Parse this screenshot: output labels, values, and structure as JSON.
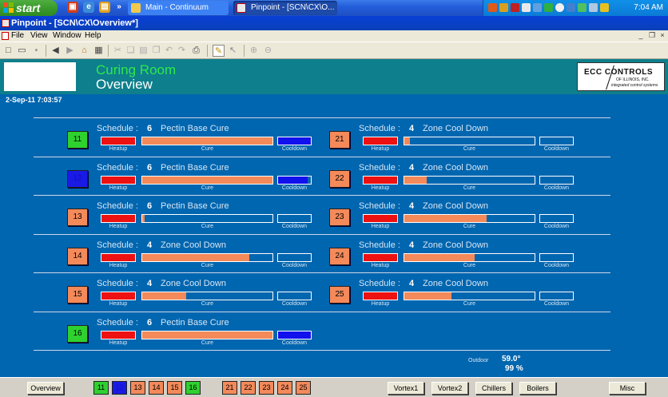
{
  "colors": {
    "heatup": "#ee1111",
    "cure": "#f4895a",
    "cooldown": "#1111ee",
    "room_green": "#2fd12f",
    "room_blue": "#1a1ae6",
    "room_orange": "#f4895a"
  },
  "taskbar": {
    "start_label": "start",
    "tasks": [
      {
        "label": "Main - Continuum",
        "icon": "continuum-icon"
      },
      {
        "label": "Pinpoint - [SCN\\CX\\O...",
        "icon": "pinpoint-icon"
      }
    ],
    "clock": "7:04 AM"
  },
  "window": {
    "title": "Pinpoint - [SCN\\CX\\Overview*]"
  },
  "menu": [
    "File",
    "View",
    "Window",
    "Help"
  ],
  "header": {
    "room_title": "Curing Room",
    "page_title": "Overview",
    "logo_main": "ECC CONTROLS",
    "logo_sub": "OF ILLINOIS, INC.",
    "logo_tag": "integrated control systems"
  },
  "datetime": "2-Sep-11  7:03:57",
  "labels": {
    "schedule": "Schedule :",
    "heatup": "Heatup",
    "cure": "Cure",
    "cooldown": "Cooldown"
  },
  "rooms": [
    {
      "id": "11",
      "schedule_num": "6",
      "schedule_name": "Pectin Base Cure",
      "status": "green",
      "heatup": 1.0,
      "cure": 1.0,
      "cooldown": 1.0
    },
    {
      "id": "21",
      "schedule_num": "4",
      "schedule_name": "Zone Cool Down",
      "status": "orange",
      "heatup": 1.0,
      "cure": 0.04,
      "cooldown": 0.0
    },
    {
      "id": "12",
      "schedule_num": "6",
      "schedule_name": "Pectin Base Cure",
      "status": "blue",
      "heatup": 1.0,
      "cure": 1.0,
      "cooldown": 0.9
    },
    {
      "id": "22",
      "schedule_num": "4",
      "schedule_name": "Zone Cool Down",
      "status": "orange",
      "heatup": 1.0,
      "cure": 0.17,
      "cooldown": 0.0
    },
    {
      "id": "13",
      "schedule_num": "6",
      "schedule_name": "Pectin Base Cure",
      "status": "orange",
      "heatup": 1.0,
      "cure": 0.02,
      "cooldown": 0.0
    },
    {
      "id": "23",
      "schedule_num": "4",
      "schedule_name": "Zone Cool Down",
      "status": "orange",
      "heatup": 1.0,
      "cure": 0.63,
      "cooldown": 0.0
    },
    {
      "id": "14",
      "schedule_num": "4",
      "schedule_name": "Zone Cool Down",
      "status": "orange",
      "heatup": 1.0,
      "cure": 0.82,
      "cooldown": 0.0
    },
    {
      "id": "24",
      "schedule_num": "4",
      "schedule_name": "Zone Cool Down",
      "status": "orange",
      "heatup": 1.0,
      "cure": 0.54,
      "cooldown": 0.0
    },
    {
      "id": "15",
      "schedule_num": "4",
      "schedule_name": "Zone Cool Down",
      "status": "orange",
      "heatup": 1.0,
      "cure": 0.34,
      "cooldown": 0.0
    },
    {
      "id": "25",
      "schedule_num": "4",
      "schedule_name": "Zone Cool Down",
      "status": "orange",
      "heatup": 1.0,
      "cure": 0.36,
      "cooldown": 0.0
    },
    {
      "id": "16",
      "schedule_num": "6",
      "schedule_name": "Pectin Base Cure",
      "status": "green",
      "heatup": 1.0,
      "cure": 1.0,
      "cooldown": 1.0
    }
  ],
  "outdoor": {
    "label": "Outdoor",
    "temperature": "59.0°",
    "humidity": "99 %"
  },
  "nav": {
    "overview": "Overview",
    "rooms": [
      {
        "id": "11",
        "status": "green"
      },
      {
        "id": "12",
        "status": "blue"
      },
      {
        "id": "13",
        "status": "orange"
      },
      {
        "id": "14",
        "status": "orange"
      },
      {
        "id": "15",
        "status": "orange"
      },
      {
        "id": "16",
        "status": "green"
      },
      {
        "id": "21",
        "status": "orange"
      },
      {
        "id": "22",
        "status": "orange"
      },
      {
        "id": "23",
        "status": "orange"
      },
      {
        "id": "24",
        "status": "orange"
      },
      {
        "id": "25",
        "status": "orange"
      }
    ],
    "buttons": [
      "Vortex1",
      "Vortex2",
      "Chillers",
      "Boilers",
      "Misc"
    ]
  }
}
